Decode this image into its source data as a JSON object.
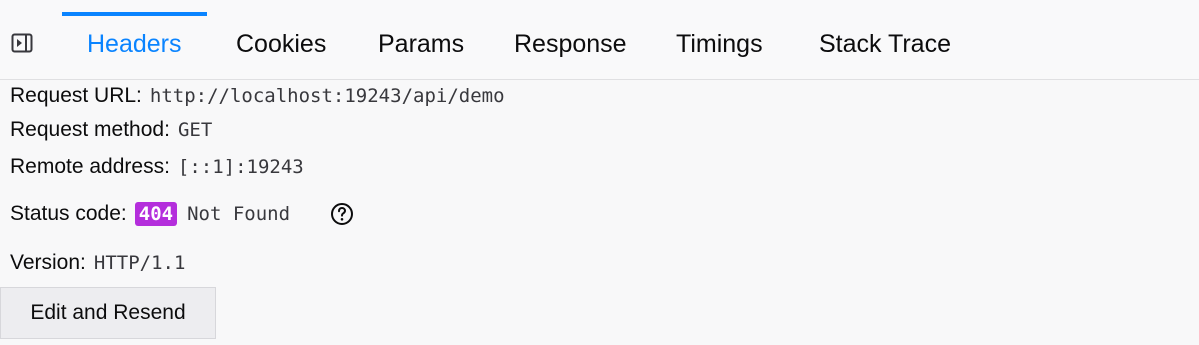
{
  "tabs": [
    {
      "label": "Headers",
      "selected": true
    },
    {
      "label": "Cookies",
      "selected": false
    },
    {
      "label": "Params",
      "selected": false
    },
    {
      "label": "Response",
      "selected": false
    },
    {
      "label": "Timings",
      "selected": false
    },
    {
      "label": "Stack Trace",
      "selected": false
    }
  ],
  "toolbar": {
    "toggle_icon": "sidebar-toggle-icon"
  },
  "summary": {
    "request_url": {
      "label": "Request URL:",
      "value": "http://localhost:19243/api/demo"
    },
    "request_method": {
      "label": "Request method:",
      "value": "GET"
    },
    "remote_address": {
      "label": "Remote address:",
      "value": "[::1]:19243"
    },
    "status_code": {
      "label": "Status code:",
      "code": "404",
      "text": "Not Found",
      "badge_color": "#b42edc",
      "help_icon": "help-icon"
    },
    "version": {
      "label": "Version:",
      "value": "HTTP/1.1"
    }
  },
  "actions": {
    "edit_resend_label": "Edit and Resend"
  },
  "colors": {
    "accent": "#0a84ff",
    "status_4xx": "#b42edc"
  }
}
